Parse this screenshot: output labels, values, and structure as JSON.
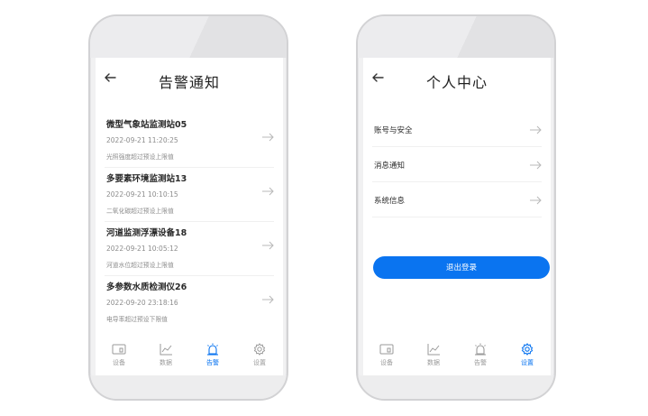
{
  "left_screen": {
    "title": "告警通知",
    "alerts": [
      {
        "name": "微型气象站监测站05",
        "time": "2022-09-21 11:20:25",
        "desc": "光照强度超过预设上限值"
      },
      {
        "name": "多要素环境监测站13",
        "time": "2022-09-21 10:10:15",
        "desc": "二氧化碳超过预设上限值"
      },
      {
        "name": "河道监测浮漂设备18",
        "time": "2022-09-21 10:05:12",
        "desc": "河道水位超过预设上限值"
      },
      {
        "name": "多参数水质检测仪26",
        "time": "2022-09-20 23:18:16",
        "desc": "电导率超过预设下限值"
      }
    ],
    "tabs": [
      {
        "label": "设备",
        "icon": "device-icon"
      },
      {
        "label": "数据",
        "icon": "chart-icon"
      },
      {
        "label": "告警",
        "icon": "alarm-icon"
      },
      {
        "label": "设置",
        "icon": "gear-icon"
      }
    ],
    "active_tab": "告警"
  },
  "right_screen": {
    "title": "个人中心",
    "menu": [
      {
        "label": "账号与安全"
      },
      {
        "label": "消息通知"
      },
      {
        "label": "系统信息"
      }
    ],
    "logout_label": "退出登录",
    "tabs": [
      {
        "label": "设备",
        "icon": "device-icon"
      },
      {
        "label": "数据",
        "icon": "chart-icon"
      },
      {
        "label": "告警",
        "icon": "alarm-icon"
      },
      {
        "label": "设置",
        "icon": "gear-icon"
      }
    ],
    "active_tab": "设置"
  },
  "colors": {
    "accent": "#0a74f0",
    "inactive": "#9a9a9a",
    "text": "#2a2a2a",
    "muted": "#8c8c8c"
  }
}
